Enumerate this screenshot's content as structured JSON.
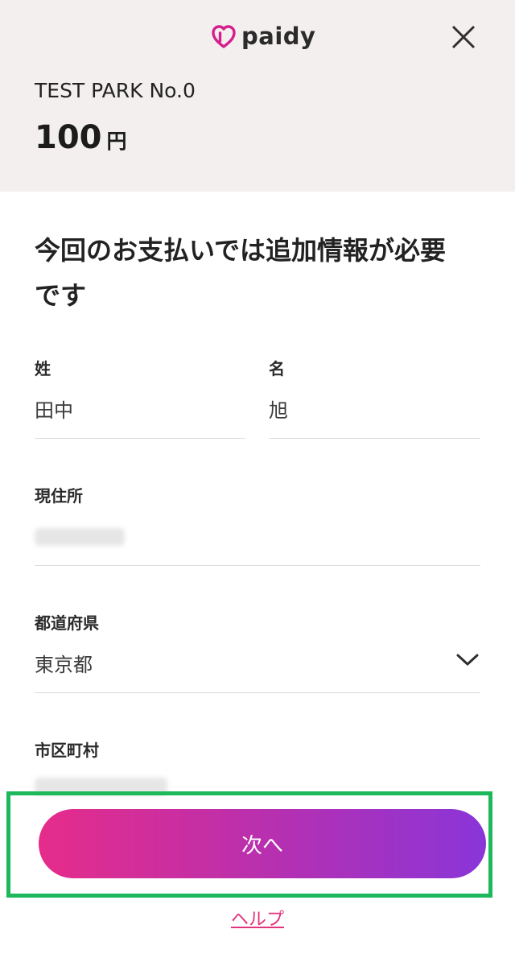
{
  "header": {
    "logo_text": "paidy",
    "close_icon": "close-icon",
    "merchant_name": "TEST PARK No.0",
    "amount_value": "100",
    "amount_unit": "円"
  },
  "form": {
    "heading_line1": "今回のお支払いでは追加情報が必要",
    "heading_line2": "です",
    "last_name": {
      "label": "姓",
      "value": "田中"
    },
    "first_name": {
      "label": "名",
      "value": "旭"
    },
    "address": {
      "label": "現住所"
    },
    "prefecture": {
      "label": "都道府県",
      "value": "東京都",
      "icon": "chevron-down-icon"
    },
    "city": {
      "label": "市区町村"
    }
  },
  "actions": {
    "next_label": "次へ",
    "help_label": "ヘルプ"
  },
  "colors": {
    "header_bg": "#f4efef",
    "button_gradient_start": "#e62c8a",
    "button_gradient_end": "#8a35d8",
    "highlight_border": "#1db85c",
    "link": "#e0357c"
  }
}
